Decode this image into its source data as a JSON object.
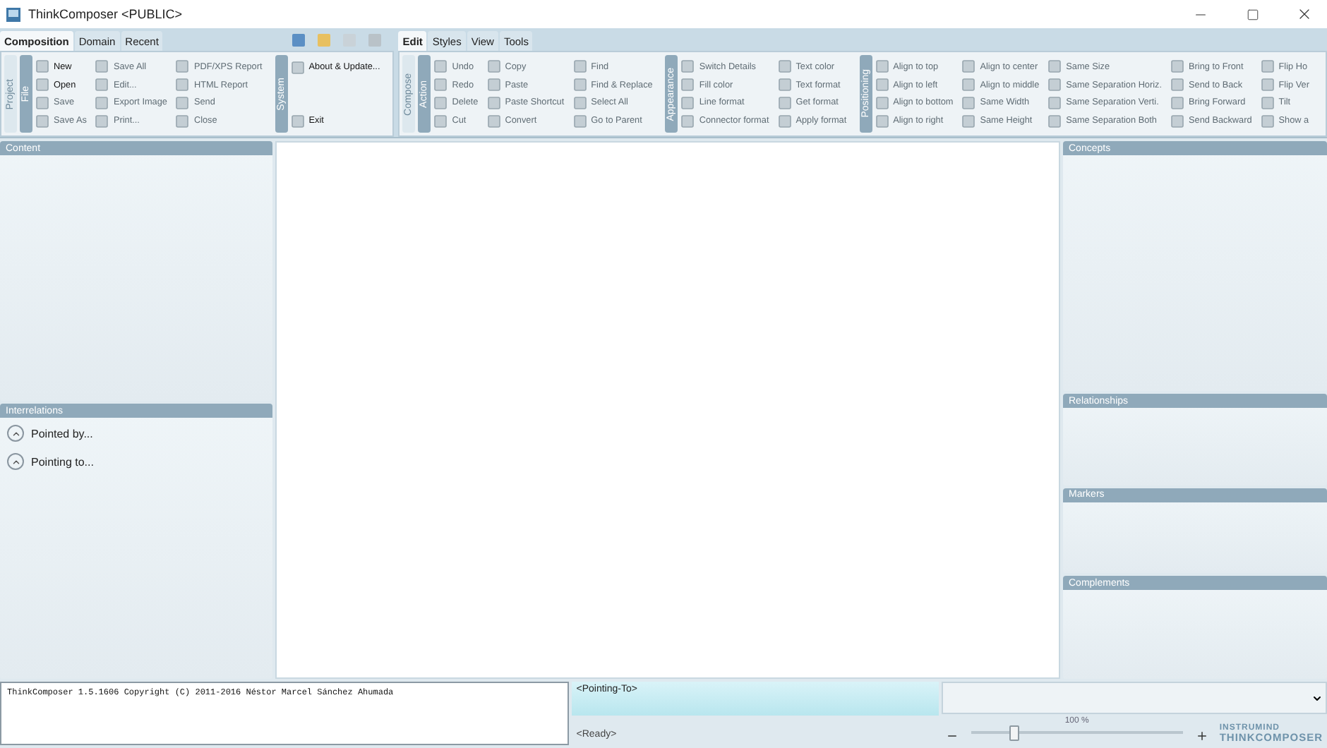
{
  "window": {
    "title": "ThinkComposer <PUBLIC>"
  },
  "ribbons": [
    {
      "tabs": [
        {
          "label": "Composition",
          "selected": true
        },
        {
          "label": "Domain",
          "selected": false
        },
        {
          "label": "Recent",
          "selected": false
        }
      ],
      "group": "Project",
      "sections": [
        {
          "label": "File",
          "columns": [
            [
              {
                "label": "New",
                "disabled": false
              },
              {
                "label": "Open",
                "disabled": false
              },
              {
                "label": "Save",
                "disabled": true
              },
              {
                "label": "Save As",
                "disabled": true
              }
            ],
            [
              {
                "label": "Save All",
                "disabled": true
              },
              {
                "label": "Edit...",
                "disabled": true
              },
              {
                "label": "Export Image",
                "disabled": true
              },
              {
                "label": "Print...",
                "disabled": true
              }
            ],
            [
              {
                "label": "PDF/XPS Report",
                "disabled": true
              },
              {
                "label": "HTML Report",
                "disabled": true
              },
              {
                "label": "Send",
                "disabled": true
              },
              {
                "label": "Close",
                "disabled": true
              }
            ]
          ]
        },
        {
          "label": "System",
          "columns": [
            [
              {
                "label": "About & Update...",
                "disabled": false
              },
              {
                "label": "Exit",
                "disabled": false
              }
            ]
          ]
        }
      ]
    },
    {
      "tabs": [
        {
          "label": "Edit",
          "selected": true
        },
        {
          "label": "Styles",
          "selected": false
        },
        {
          "label": "View",
          "selected": false
        },
        {
          "label": "Tools",
          "selected": false
        }
      ],
      "group": "Compose",
      "sections": [
        {
          "label": "Action",
          "columns": [
            [
              {
                "label": "Undo",
                "disabled": true
              },
              {
                "label": "Redo",
                "disabled": true
              },
              {
                "label": "Delete",
                "disabled": true
              },
              {
                "label": "Cut",
                "disabled": true
              }
            ],
            [
              {
                "label": "Copy",
                "disabled": true
              },
              {
                "label": "Paste",
                "disabled": true
              },
              {
                "label": "Paste Shortcut",
                "disabled": true
              },
              {
                "label": "Convert",
                "disabled": true
              }
            ],
            [
              {
                "label": "Find",
                "disabled": true
              },
              {
                "label": "Find & Replace",
                "disabled": true
              },
              {
                "label": "Select All",
                "disabled": true
              },
              {
                "label": "Go to Parent",
                "disabled": true
              }
            ]
          ]
        },
        {
          "label": "Appearance",
          "columns": [
            [
              {
                "label": "Switch Details",
                "disabled": true
              },
              {
                "label": "Fill color",
                "disabled": true
              },
              {
                "label": "Line format",
                "disabled": true
              },
              {
                "label": "Connector format",
                "disabled": true
              }
            ],
            [
              {
                "label": "Text color",
                "disabled": true
              },
              {
                "label": "Text format",
                "disabled": true
              },
              {
                "label": "Get format",
                "disabled": true
              },
              {
                "label": "Apply format",
                "disabled": true
              }
            ]
          ]
        },
        {
          "label": "Positioning",
          "columns": [
            [
              {
                "label": "Align to top",
                "disabled": true
              },
              {
                "label": "Align to left",
                "disabled": true
              },
              {
                "label": "Align to bottom",
                "disabled": true
              },
              {
                "label": "Align to right",
                "disabled": true
              }
            ],
            [
              {
                "label": "Align to center",
                "disabled": true
              },
              {
                "label": "Align to middle",
                "disabled": true
              },
              {
                "label": "Same Width",
                "disabled": true
              },
              {
                "label": "Same Height",
                "disabled": true
              }
            ],
            [
              {
                "label": "Same Size",
                "disabled": true
              },
              {
                "label": "Same Separation Horiz.",
                "disabled": true
              },
              {
                "label": "Same Separation Verti.",
                "disabled": true
              },
              {
                "label": "Same Separation Both",
                "disabled": true
              }
            ],
            [
              {
                "label": "Bring to Front",
                "disabled": true
              },
              {
                "label": "Send to Back",
                "disabled": true
              },
              {
                "label": "Bring Forward",
                "disabled": true
              },
              {
                "label": "Send Backward",
                "disabled": true
              }
            ],
            [
              {
                "label": "Flip Ho",
                "disabled": true
              },
              {
                "label": "Flip Ver",
                "disabled": true
              },
              {
                "label": "Tilt",
                "disabled": true
              },
              {
                "label": "Show a",
                "disabled": true
              }
            ]
          ]
        }
      ]
    }
  ],
  "left_panels": [
    {
      "title": "Content"
    },
    {
      "title": "Interrelations",
      "items": [
        "Pointed by...",
        "Pointing to..."
      ]
    }
  ],
  "right_panels": [
    {
      "title": "Concepts"
    },
    {
      "title": "Relationships"
    },
    {
      "title": "Markers"
    },
    {
      "title": "Complements"
    }
  ],
  "status": {
    "log": "ThinkComposer 1.5.1606 Copyright (C) 2011-2016 Néstor Marcel Sánchez Ahumada",
    "pointing": "<Pointing-To>",
    "message": "<Ready>",
    "zoom": {
      "reading": "100 %",
      "level": 0.2
    },
    "logo": [
      "INSTRUMIND",
      "THINKCOMPOSER"
    ]
  }
}
